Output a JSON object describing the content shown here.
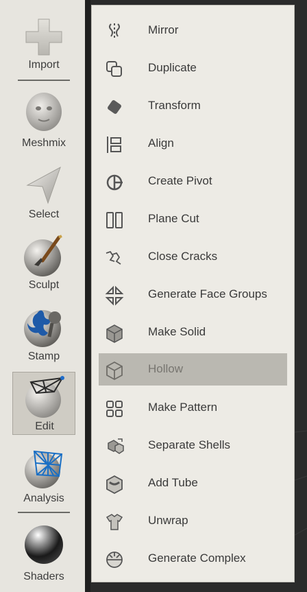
{
  "sidebar": {
    "tools": [
      {
        "label": "Import",
        "icon": "import-plus-icon"
      },
      {
        "label": "Meshmix",
        "icon": "meshmix-head-icon"
      },
      {
        "label": "Select",
        "icon": "select-arrow-icon"
      },
      {
        "label": "Sculpt",
        "icon": "sculpt-brush-icon"
      },
      {
        "label": "Stamp",
        "icon": "stamp-fleur-icon"
      },
      {
        "label": "Edit",
        "icon": "edit-mesh-icon",
        "active": true
      },
      {
        "label": "Analysis",
        "icon": "analysis-mesh-icon"
      },
      {
        "label": "Shaders",
        "icon": "shaders-sphere-icon"
      }
    ]
  },
  "menu": {
    "items": [
      {
        "label": "Mirror",
        "icon": "mirror-icon"
      },
      {
        "label": "Duplicate",
        "icon": "duplicate-icon"
      },
      {
        "label": "Transform",
        "icon": "transform-icon"
      },
      {
        "label": "Align",
        "icon": "align-icon"
      },
      {
        "label": "Create Pivot",
        "icon": "create-pivot-icon"
      },
      {
        "label": "Plane Cut",
        "icon": "plane-cut-icon"
      },
      {
        "label": "Close Cracks",
        "icon": "close-cracks-icon"
      },
      {
        "label": "Generate Face Groups",
        "icon": "generate-face-groups-icon"
      },
      {
        "label": "Make Solid",
        "icon": "make-solid-icon"
      },
      {
        "label": "Hollow",
        "icon": "hollow-icon",
        "highlighted": true
      },
      {
        "label": "Make Pattern",
        "icon": "make-pattern-icon"
      },
      {
        "label": "Separate Shells",
        "icon": "separate-shells-icon"
      },
      {
        "label": "Add Tube",
        "icon": "add-tube-icon"
      },
      {
        "label": "Unwrap",
        "icon": "unwrap-icon"
      },
      {
        "label": "Generate Complex",
        "icon": "generate-complex-icon"
      }
    ]
  },
  "colors": {
    "panel": "#edebe5",
    "sidebar": "#e7e5df",
    "highlight": "#bab8b1",
    "background": "#2b2b2b"
  }
}
